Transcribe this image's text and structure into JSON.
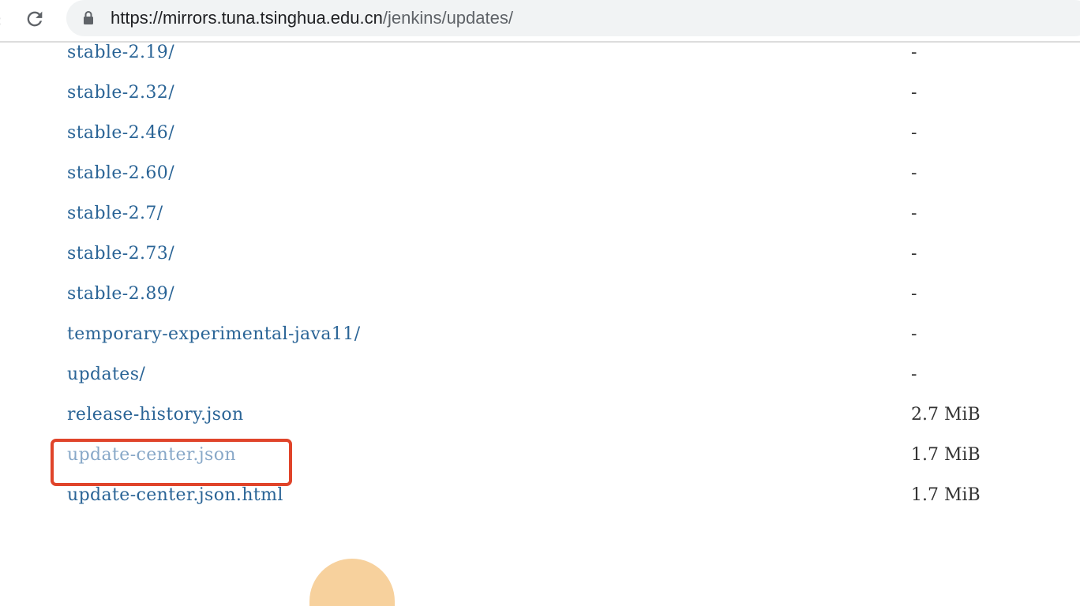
{
  "browser": {
    "url_host": "https://mirrors.tuna.tsinghua.edu.cn",
    "url_path": "/jenkins/updates/",
    "reload_icon": "reload-icon",
    "lock_icon": "lock-icon"
  },
  "listing": {
    "entries": [
      {
        "name": "stable-2.19/",
        "size": "-"
      },
      {
        "name": "stable-2.32/",
        "size": "-"
      },
      {
        "name": "stable-2.46/",
        "size": "-"
      },
      {
        "name": "stable-2.60/",
        "size": "-"
      },
      {
        "name": "stable-2.7/",
        "size": "-"
      },
      {
        "name": "stable-2.73/",
        "size": "-"
      },
      {
        "name": "stable-2.89/",
        "size": "-"
      },
      {
        "name": "temporary-experimental-java11/",
        "size": "-"
      },
      {
        "name": "updates/",
        "size": "-"
      },
      {
        "name": "release-history.json",
        "size": "2.7 MiB"
      },
      {
        "name": "update-center.json",
        "size": "1.7 MiB"
      },
      {
        "name": "update-center.json.html",
        "size": "1.7 MiB"
      }
    ]
  },
  "annotation": {
    "highlight_color": "#e0442a"
  },
  "colors": {
    "link": "#2a6496",
    "highlighted_link": "#88a8c8",
    "size_text": "#333333"
  }
}
